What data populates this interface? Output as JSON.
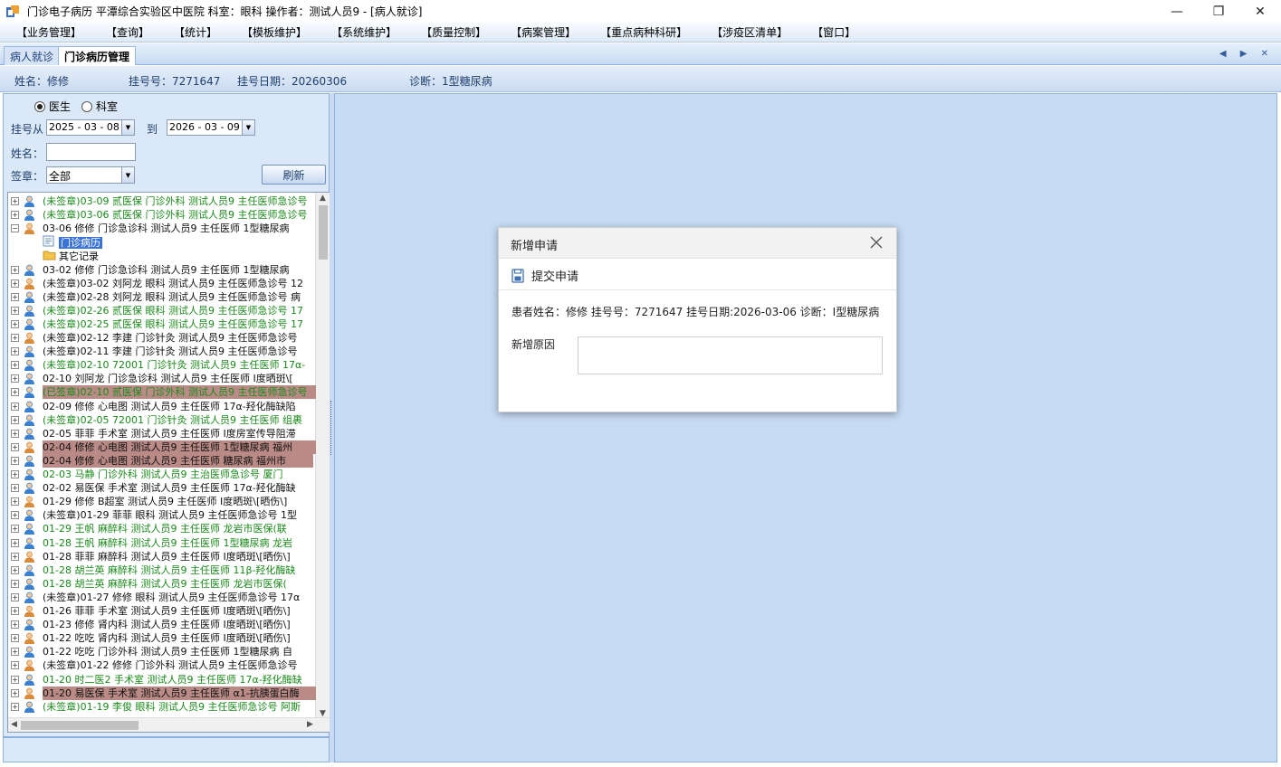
{
  "window": {
    "title": "门诊电子病历  平潭综合实验区中医院  科室：眼科  操作者：测试人员9 - [病人就诊]",
    "minimize": "—",
    "maximize": "❐",
    "close": "✕"
  },
  "menu": [
    "【业务管理】",
    "【查询】",
    "【统计】",
    "【模板维护】",
    "【系统维护】",
    "【质量控制】",
    "【病案管理】",
    "【重点病种科研】",
    "【涉疫区清单】",
    "【窗口】"
  ],
  "tabs": [
    {
      "label": "病人就诊"
    },
    {
      "label": "门诊病历管理"
    }
  ],
  "tab_arrows": "◀ ▶ ✕",
  "patient": {
    "name": "姓名：修修",
    "reg_no": "挂号号：7271647",
    "reg_date": "挂号日期：20260306",
    "diagnosis": "诊断：1型糖尿病"
  },
  "filter": {
    "radio_doctor": "医生",
    "radio_dept": "科室",
    "reg_from_label": "挂号从",
    "date_from": "2025 - 03 - 08",
    "to_label": "到",
    "date_to": "2026 - 03 - 09",
    "name_label": "姓名：",
    "name_value": "",
    "sign_label": "签章：",
    "sign_value": "全部",
    "refresh": "刷新"
  },
  "tree": [
    {
      "text": "(未签章)03-09 贰医保 门诊外科 测试人员9 主任医师急诊号",
      "color": "green",
      "highlight": false,
      "expanded": false
    },
    {
      "text": "(未签章)03-06 贰医保 门诊外科 测试人员9 主任医师急诊号",
      "color": "green",
      "highlight": false,
      "expanded": false
    },
    {
      "text": "03-06 修修 门诊急诊科 测试人员9 主任医师 1型糖尿病",
      "color": "black",
      "highlight": false,
      "expanded": true
    },
    {
      "text": "03-02 修修 门诊急诊科 测试人员9 主任医师 1型糖尿病",
      "color": "black",
      "highlight": false,
      "expanded": false
    },
    {
      "text": "(未签章)03-02 刘阿龙 眼科 测试人员9 主任医师急诊号 12",
      "color": "black",
      "highlight": false,
      "expanded": false
    },
    {
      "text": "(未签章)02-28 刘阿龙 眼科 测试人员9 主任医师急诊号 病",
      "color": "black",
      "highlight": false,
      "expanded": false
    },
    {
      "text": "(未签章)02-26 贰医保 眼科 测试人员9 主任医师急诊号 17",
      "color": "green",
      "highlight": false,
      "expanded": false
    },
    {
      "text": "(未签章)02-25 贰医保 眼科 测试人员9 主任医师急诊号 17",
      "color": "green",
      "highlight": false,
      "expanded": false
    },
    {
      "text": "(未签章)02-12 李建 门诊针灸 测试人员9 主任医师急诊号",
      "color": "black",
      "highlight": false,
      "expanded": false
    },
    {
      "text": "(未签章)02-11 李建 门诊针灸 测试人员9 主任医师急诊号",
      "color": "black",
      "highlight": false,
      "expanded": false
    },
    {
      "text": "(未签章)02-10 72001 门诊针灸 测试人员9 主任医师 17α-",
      "color": "green",
      "highlight": false,
      "expanded": false
    },
    {
      "text": "02-10 刘阿龙 门诊急诊科 测试人员9 主任医师 I度晒斑\\[",
      "color": "black",
      "highlight": false,
      "expanded": false
    },
    {
      "text": "(已签章)02-10 贰医保 门诊外科 测试人员9 主任医师急诊号",
      "color": "green",
      "highlight": true,
      "expanded": false
    },
    {
      "text": "02-09 修修 心电图 测试人员9 主任医师 17α-羟化酶缺陷",
      "color": "black",
      "highlight": false,
      "expanded": false
    },
    {
      "text": "(未签章)02-05 72001 门诊针灸 测试人员9 主任医师 组裹",
      "color": "green",
      "highlight": false,
      "expanded": false
    },
    {
      "text": "02-05 菲菲 手术室 测试人员9 主任医师 I度房室传导阻滞",
      "color": "black",
      "highlight": false,
      "expanded": false
    },
    {
      "text": "02-04 修修 心电图 测试人员9 主任医师 1型糖尿病   福州",
      "color": "black",
      "highlight": true,
      "expanded": false
    },
    {
      "text": "02-04 修修 心电图 测试人员9 主任医师 糖尿病   福州市",
      "color": "black",
      "highlight": true,
      "expanded": false
    },
    {
      "text": "02-03 马静 门诊外科 测试人员9 主治医师急诊号    厦门",
      "color": "green",
      "highlight": false,
      "expanded": false
    },
    {
      "text": "02-02 易医保 手术室 测试人员9 主任医师 17α-羟化酶缺",
      "color": "black",
      "highlight": false,
      "expanded": false
    },
    {
      "text": "01-29 修修 B超室 测试人员9 主任医师 I度晒斑\\[晒伤\\]",
      "color": "black",
      "highlight": false,
      "expanded": false
    },
    {
      "text": "(未签章)01-29 菲菲 眼科 测试人员9 主任医师急诊号 1型",
      "color": "black",
      "highlight": false,
      "expanded": false
    },
    {
      "text": "01-29 王帆 麻醉科 测试人员9 主任医师     龙岩市医保(联",
      "color": "green",
      "highlight": false,
      "expanded": false
    },
    {
      "text": "01-28 王帆 麻醉科 测试人员9 主任医师 1型糖尿病   龙岩",
      "color": "green",
      "highlight": false,
      "expanded": false
    },
    {
      "text": "01-28 菲菲 麻醉科 测试人员9 主任医师 I度晒斑\\[晒伤\\]",
      "color": "black",
      "highlight": false,
      "expanded": false
    },
    {
      "text": "01-28 胡兰英 麻醉科 测试人员9 主任医师 11β-羟化酶缺",
      "color": "green",
      "highlight": false,
      "expanded": false
    },
    {
      "text": "01-28 胡兰英 麻醉科 测试人员9 主任医师     龙岩市医保(",
      "color": "green",
      "highlight": false,
      "expanded": false
    },
    {
      "text": "(未签章)01-27 修修 眼科 测试人员9 主任医师急诊号 17α",
      "color": "black",
      "highlight": false,
      "expanded": false
    },
    {
      "text": "01-26 菲菲 手术室 测试人员9 主任医师 I度晒斑\\[晒伤\\]",
      "color": "black",
      "highlight": false,
      "expanded": false
    },
    {
      "text": "01-23 修修 肾内科 测试人员9 主任医师 I度晒斑\\[晒伤\\]",
      "color": "black",
      "highlight": false,
      "expanded": false
    },
    {
      "text": "01-22 吃吃 肾内科 测试人员9 主任医师 I度晒斑\\[晒伤\\]",
      "color": "black",
      "highlight": false,
      "expanded": false
    },
    {
      "text": "01-22 吃吃 门诊外科 测试人员9 主任医师 1型糖尿病    自",
      "color": "black",
      "highlight": false,
      "expanded": false
    },
    {
      "text": "(未签章)01-22 修修 门诊外科 测试人员9 主任医师急诊号",
      "color": "black",
      "highlight": false,
      "expanded": false
    },
    {
      "text": "01-20 时二医2 手术室 测试人员9 主任医师 17α-羟化酶缺",
      "color": "green",
      "highlight": false,
      "expanded": false
    },
    {
      "text": "01-20 易医保 手术室 测试人员9 主任医师 α1-抗胰蛋白酶",
      "color": "black",
      "highlight": true,
      "expanded": false
    },
    {
      "text": "(未签章)01-19 李俊 眼科 测试人员9 主任医师急诊号 阿斯",
      "color": "green",
      "highlight": false,
      "expanded": false
    }
  ],
  "tree_children": [
    "门诊病历",
    "其它记录"
  ],
  "dialog": {
    "title": "新增申请",
    "submit": "提交申请",
    "patient_info": "患者姓名：修修  挂号号：7271647 挂号日期:2026-03-06  诊断：I型糖尿病",
    "reason_label": "新增原因",
    "reason_value": ""
  },
  "colors": {
    "green": "#1a8a1a",
    "black": "#111111",
    "highlight": "#b98a86",
    "panel": "#c6dbf4"
  }
}
